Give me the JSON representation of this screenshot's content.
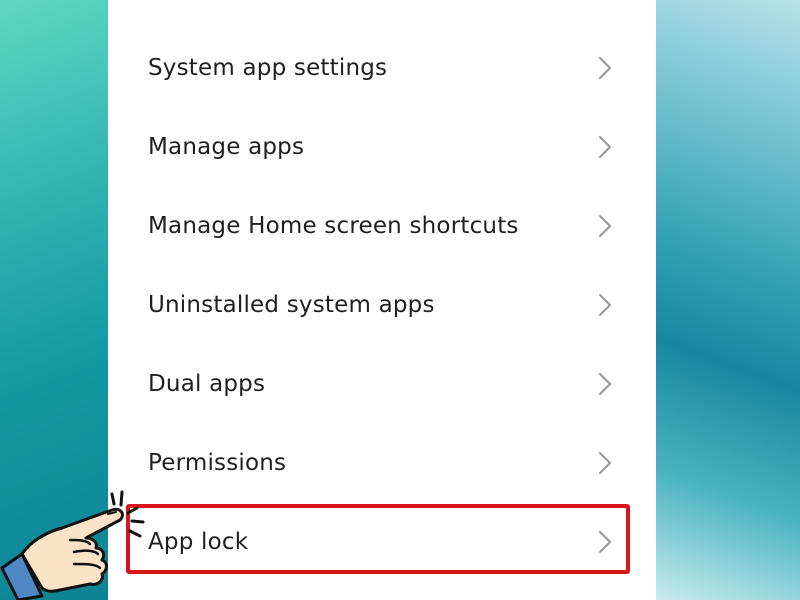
{
  "menu": {
    "items": [
      {
        "label": "System app settings",
        "icon": "chevron-right-icon"
      },
      {
        "label": "Manage apps",
        "icon": "chevron-right-icon"
      },
      {
        "label": "Manage Home screen shortcuts",
        "icon": "chevron-right-icon"
      },
      {
        "label": "Uninstalled system apps",
        "icon": "chevron-right-icon"
      },
      {
        "label": "Dual apps",
        "icon": "chevron-right-icon"
      },
      {
        "label": "Permissions",
        "icon": "chevron-right-icon"
      },
      {
        "label": "App lock",
        "icon": "chevron-right-icon",
        "highlighted": true
      }
    ]
  },
  "annotation": {
    "highlight_color": "#d8141c",
    "pointer_icon": "pointing-hand-icon"
  },
  "colors": {
    "panel_background": "#ffffff",
    "text": "#1f1f1f",
    "chevron": "#9a9a9a"
  }
}
